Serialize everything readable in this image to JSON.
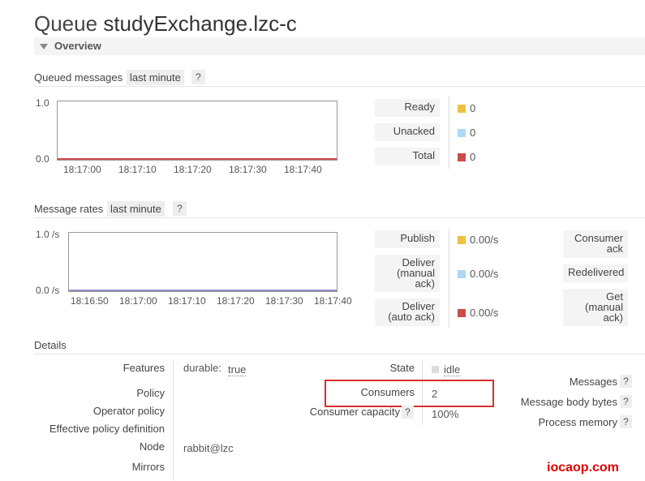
{
  "title": {
    "prefix": "Queue",
    "name": "studyExchange.lzc-c"
  },
  "overview": {
    "label": "Overview"
  },
  "queued": {
    "heading": "Queued messages",
    "range": "last minute",
    "help": "?",
    "chart_data": {
      "type": "line",
      "ylim": [
        0,
        1
      ],
      "yticks": [
        "1.0",
        "0.0"
      ],
      "xticks": [
        "18:17:00",
        "18:17:10",
        "18:17:20",
        "18:17:30",
        "18:17:40"
      ],
      "series": [
        {
          "name": "Ready",
          "values": [
            0,
            0
          ]
        },
        {
          "name": "Unacked",
          "values": [
            0,
            0
          ]
        },
        {
          "name": "Total",
          "values": [
            0,
            0
          ]
        }
      ]
    },
    "legend": [
      {
        "label": "Ready",
        "value": "0",
        "color": "#edc240"
      },
      {
        "label": "Unacked",
        "value": "0",
        "color": "#afd8f8"
      },
      {
        "label": "Total",
        "value": "0",
        "color": "#cb4b4b"
      }
    ]
  },
  "rates": {
    "heading": "Message rates",
    "range": "last minute",
    "help": "?",
    "chart_data": {
      "type": "line",
      "ylim": [
        0,
        1
      ],
      "yticks": [
        "1.0 /s",
        "0.0 /s"
      ],
      "xticks": [
        "18:16:50",
        "18:17:00",
        "18:17:10",
        "18:17:20",
        "18:17:30",
        "18:17:40"
      ],
      "series": [
        {
          "name": "Publish",
          "values": [
            0,
            0
          ]
        },
        {
          "name": "Deliver (manual ack)",
          "values": [
            0,
            0
          ]
        },
        {
          "name": "Deliver (auto ack)",
          "values": [
            0,
            0
          ]
        }
      ]
    },
    "legend": [
      {
        "label": "Publish",
        "value": "0.00/s",
        "color": "#edc240"
      },
      {
        "label": "Deliver (manual ack)",
        "value": "0.00/s",
        "color": "#afd8f8"
      },
      {
        "label": "Deliver (auto ack)",
        "value": "0.00/s",
        "color": "#cb4b4b"
      }
    ],
    "right_buttons": [
      "Consumer ack",
      "Redelivered",
      "Get (manual ack)"
    ]
  },
  "details": {
    "heading": "Details",
    "features_label": "Features",
    "features_key": "durable:",
    "features_value": "true",
    "policy_label": "Policy",
    "operator_policy_label": "Operator policy",
    "effective_policy_label": "Effective policy definition",
    "node_label": "Node",
    "node_value": "rabbit@lzc",
    "mirrors_label": "Mirrors",
    "state_label": "State",
    "state_value": "idle",
    "consumers_label": "Consumers",
    "consumers_value": "2",
    "capacity_label": "Consumer capacity",
    "capacity_help": "?",
    "capacity_value": "100%",
    "messages_label": "Messages",
    "body_bytes_label": "Message body bytes",
    "process_memory_label": "Process memory",
    "help": "?"
  },
  "watermark": "iocaop.com"
}
